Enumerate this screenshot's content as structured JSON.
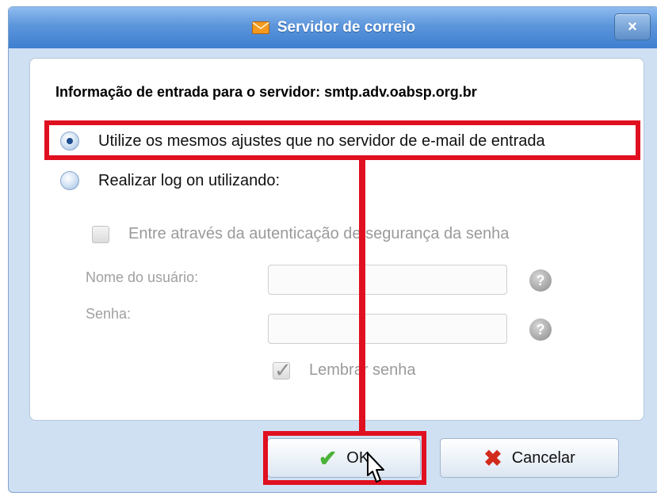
{
  "dialog": {
    "title": "Servidor de correio",
    "close_symbol": "×",
    "heading": "Informação de entrada para o servidor: smtp.adv.oabsp.org.br",
    "options": [
      {
        "label": "Utilize os mesmos ajustes que no servidor de e-mail de entrada",
        "checked": true
      },
      {
        "label": "Realizar log on utilizando:",
        "checked": false
      }
    ],
    "spa_checkbox_label": "Entre através da autenticação de segurança da senha",
    "username_label": "Nome do usuário:",
    "password_label": "Senha:",
    "username_value": "",
    "password_value": "",
    "help_symbol": "?",
    "remember_label": "Lembrar senha",
    "remember_checked": true
  },
  "buttons": {
    "ok_label": "OK",
    "cancel_label": "Cancelar"
  },
  "icons": {
    "title": "envelope-icon",
    "ok": "checkmark-icon",
    "cancel": "x-icon"
  },
  "colors": {
    "annotation": "#e01020",
    "titlebar": "#4a88d6"
  }
}
